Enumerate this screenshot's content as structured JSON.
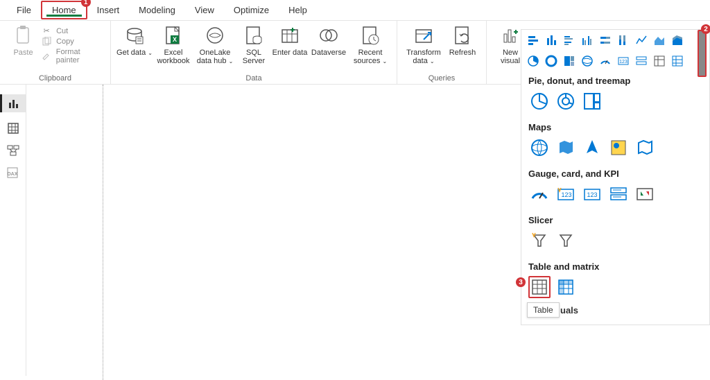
{
  "menu": {
    "file": "File",
    "home": "Home",
    "insert": "Insert",
    "modeling": "Modeling",
    "view": "View",
    "optimize": "Optimize",
    "help": "Help"
  },
  "badges": {
    "home": "1",
    "scroll": "2",
    "table": "3"
  },
  "clipboard": {
    "paste": "Paste",
    "cut": "Cut",
    "copy": "Copy",
    "format": "Format painter",
    "group": "Clipboard"
  },
  "data": {
    "get": "Get data",
    "excel": "Excel workbook",
    "onelake": "OneLake data hub",
    "sql": "SQL Server",
    "enter": "Enter data",
    "dataverse": "Dataverse",
    "recent": "Recent sources",
    "group": "Data"
  },
  "queries": {
    "transform": "Transform data",
    "refresh": "Refresh",
    "group": "Queries"
  },
  "newvisual": "New visual",
  "panel": {
    "pie_title": "Pie, donut, and treemap",
    "maps_title": "Maps",
    "gauge_title": "Gauge, card, and KPI",
    "slicer_title": "Slicer",
    "table_title": "Table and matrix",
    "other_title": "uals",
    "tooltip": "Table"
  }
}
